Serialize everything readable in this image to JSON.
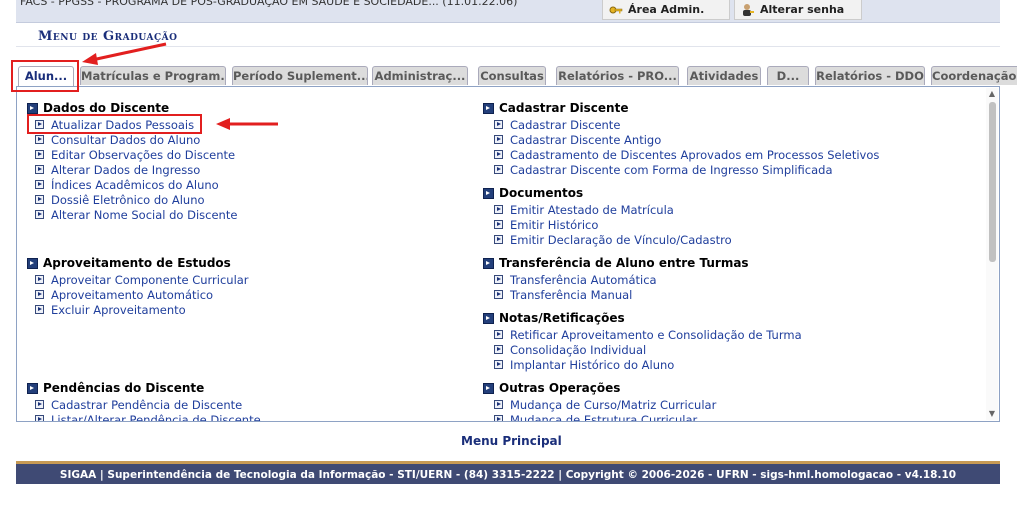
{
  "header": {
    "department": "FACS - PPGSS - PROGRAMA DE PÓS-GRADUAÇÃO EM SAÚDE E SOCIEDADE... (11.01.22.06)",
    "area_admin": "Área Admin.",
    "alterar_senha": "Alterar senha",
    "icons": [
      "key-icon",
      "user-key-icon"
    ]
  },
  "menu_title": "Menu de Graduação",
  "tabs": [
    {
      "label": "Alun...",
      "active": true
    },
    {
      "label": "Matrículas e Program..."
    },
    {
      "label": "Período Suplement..."
    },
    {
      "label": "Administraç..."
    },
    {
      "label": "Consultas"
    },
    {
      "label": "Relatórios - PRO..."
    },
    {
      "label": "Atividades"
    },
    {
      "label": "D..."
    },
    {
      "label": "Relatórios - DDO"
    },
    {
      "label": "Coordenação Únic"
    }
  ],
  "left": {
    "dados_discente": {
      "title": "Dados do Discente",
      "items": [
        "Atualizar Dados Pessoais",
        "Consultar Dados do Aluno",
        "Editar Observações do Discente",
        "Alterar Dados de Ingresso",
        "Índices Acadêmicos do Aluno",
        "Dossiê Eletrônico do Aluno",
        "Alterar Nome Social do Discente"
      ]
    },
    "aproveitamento": {
      "title": "Aproveitamento de Estudos",
      "items": [
        "Aproveitar Componente Curricular",
        "Aproveitamento Automático",
        "Excluir Aproveitamento"
      ]
    },
    "pendencias": {
      "title": "Pendências do Discente",
      "items": [
        "Cadastrar Pendência de Discente",
        "Listar/Alterar Pendência de Discente"
      ]
    }
  },
  "right": {
    "cadastrar": {
      "title": "Cadastrar Discente",
      "items": [
        "Cadastrar Discente",
        "Cadastrar Discente Antigo",
        "Cadastramento de Discentes Aprovados em Processos Seletivos",
        "Cadastrar Discente com Forma de Ingresso Simplificada"
      ]
    },
    "documentos": {
      "title": "Documentos",
      "items": [
        "Emitir Atestado de Matrícula",
        "Emitir Histórico",
        "Emitir Declaração de Vínculo/Cadastro"
      ]
    },
    "transferencia": {
      "title": "Transferência de Aluno entre Turmas",
      "items": [
        "Transferência Automática",
        "Transferência Manual"
      ]
    },
    "notas": {
      "title": "Notas/Retificações",
      "items": [
        "Retificar Aproveitamento e Consolidação de Turma",
        "Consolidação Individual",
        "Implantar Histórico do Aluno"
      ]
    },
    "outras": {
      "title": "Outras Operações",
      "items": [
        "Mudança de Curso/Matriz Curricular",
        "Mudança de Estrutura Curricular"
      ]
    }
  },
  "menu_principal": "Menu Principal",
  "footer": "SIGAA | Superintendência de Tecnologia da Informação - STI/UERN - (84) 3315-2222 | Copyright © 2006-2026 - UFRN - sigs-hml.homologacao - v4.18.10",
  "colors": {
    "highlight": "#e21f1f",
    "link": "#1f3e9c",
    "footer_bg": "#3f4a74",
    "footer_border": "#c69a55"
  }
}
